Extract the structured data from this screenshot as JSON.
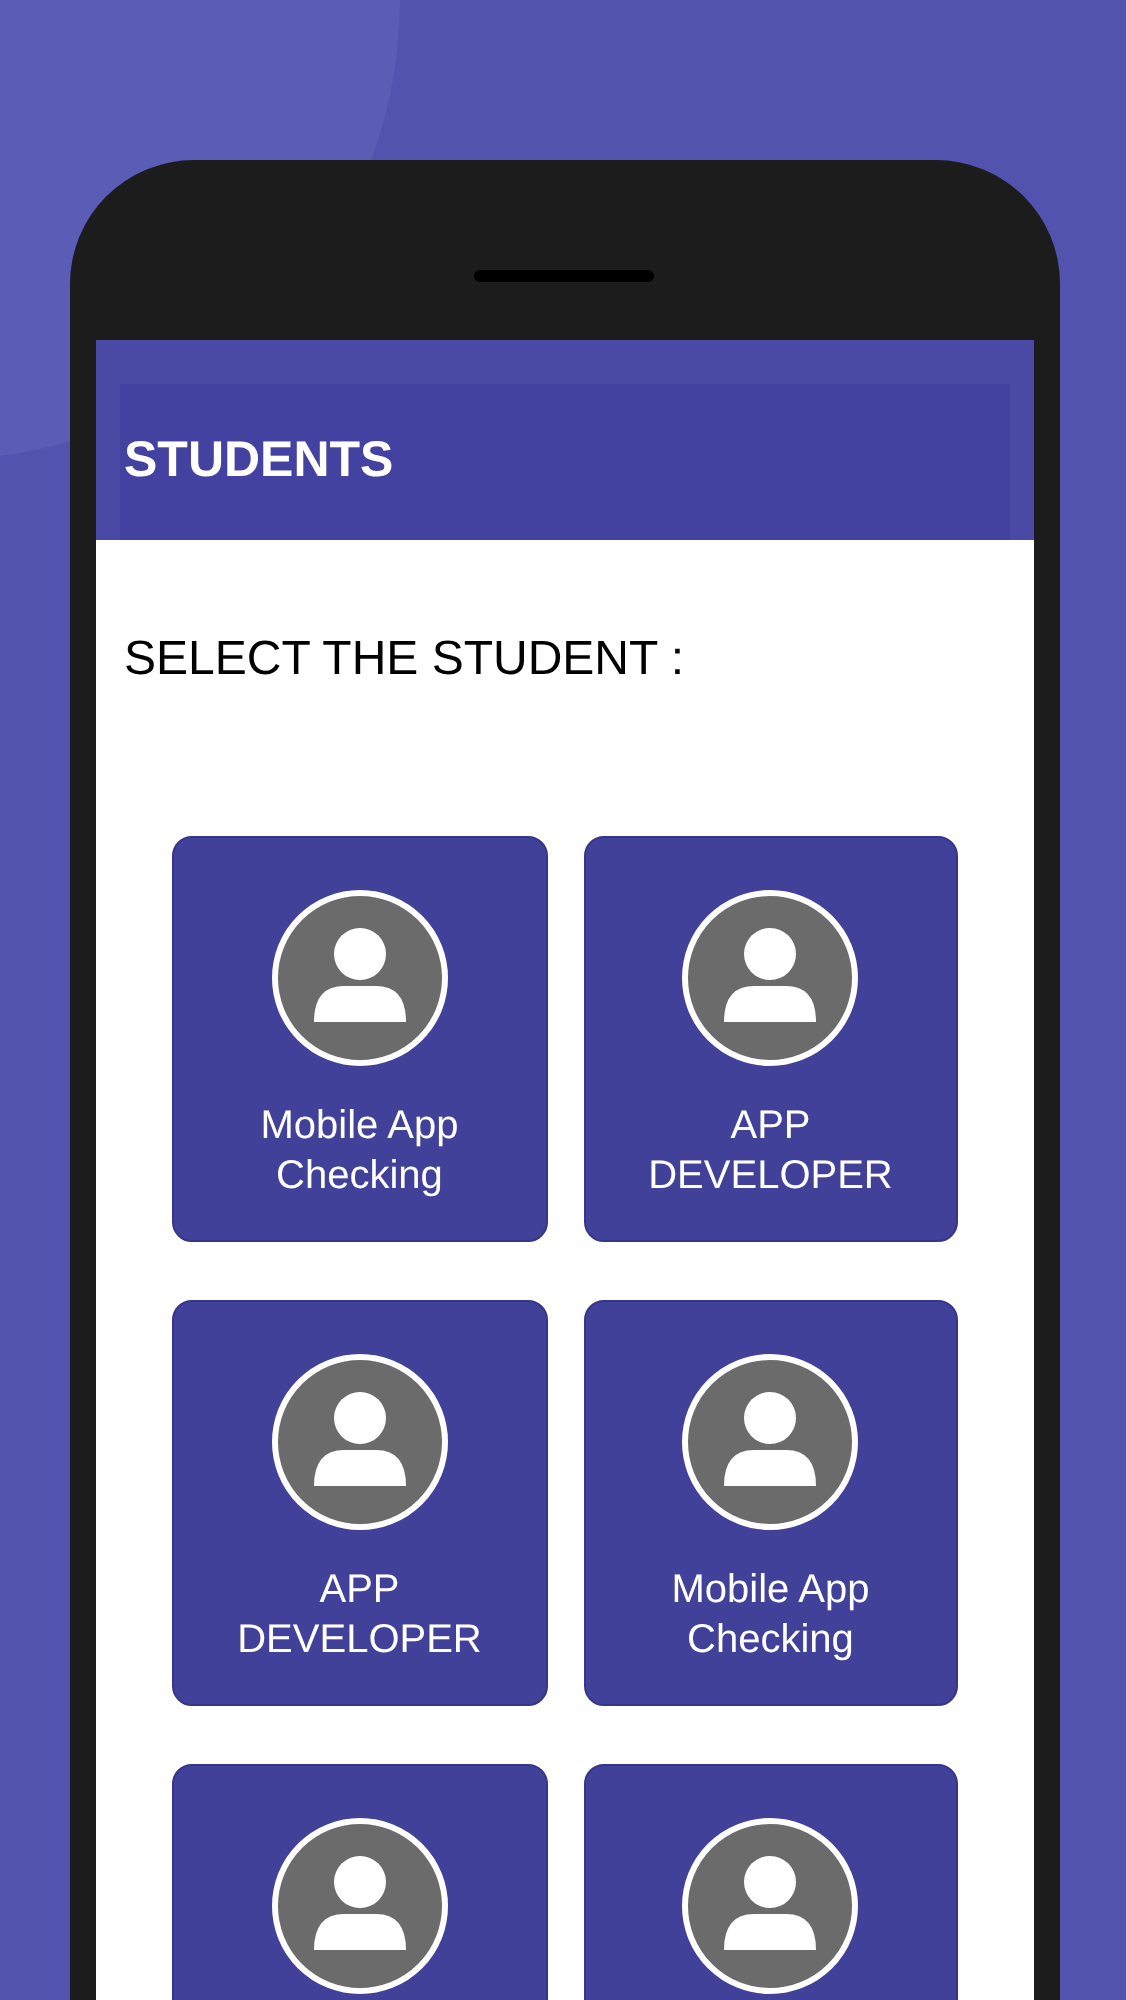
{
  "app_bar": {
    "title": "STUDENTS"
  },
  "prompt": "SELECT THE STUDENT :",
  "students": [
    {
      "kind": "named",
      "name": "Mobile App Checking"
    },
    {
      "kind": "named",
      "name": "APP DEVELOPER"
    },
    {
      "kind": "named",
      "name": "APP DEVELOPER"
    },
    {
      "kind": "named",
      "name": "Mobile App Checking"
    },
    {
      "kind": "unlabeled"
    },
    {
      "kind": "unlabeled"
    }
  ]
}
